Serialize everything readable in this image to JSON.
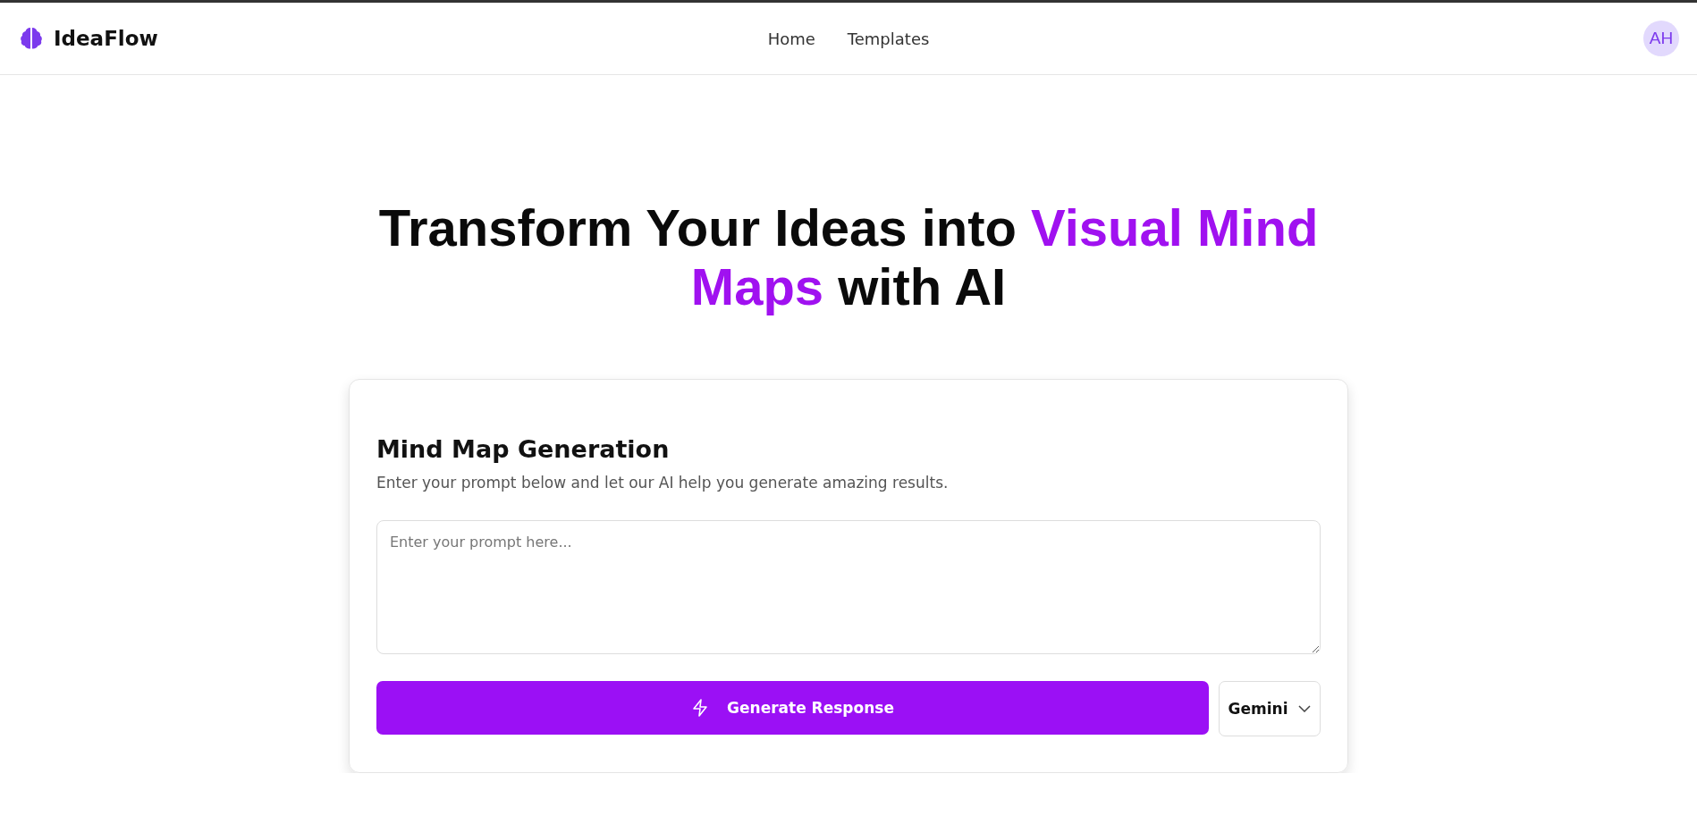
{
  "header": {
    "brand": "IdeaFlow",
    "nav": [
      {
        "label": "Home"
      },
      {
        "label": "Templates"
      }
    ],
    "avatar": "AH"
  },
  "hero": {
    "headline": [
      {
        "text": "Transform Your Ideas into ",
        "highlight": false
      },
      {
        "text": "Visual Mind Maps",
        "highlight": true
      },
      {
        "text": " with AI",
        "highlight": false
      }
    ]
  },
  "card": {
    "title": "Mind Map Generation",
    "description": "Enter your prompt below and let our AI help you generate amazing results.",
    "prompt": {
      "placeholder": "Enter your prompt here..."
    },
    "generate_button": "Generate Response",
    "model_select": "Gemini"
  }
}
